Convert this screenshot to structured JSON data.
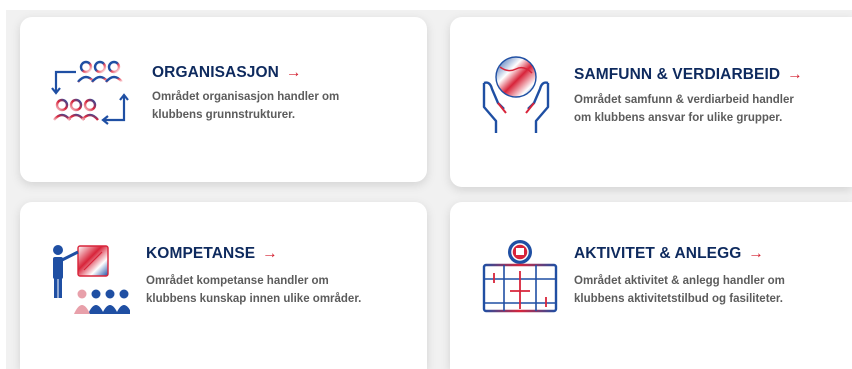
{
  "cards": [
    {
      "title": "ORGANISASJON",
      "arrow": "→",
      "desc_line1": "Området organisasjon handler om",
      "desc_line2": "klubbens grunnstrukturer.",
      "icon": "organization-cycle-icon"
    },
    {
      "title": "SAMFUNN & VERDIARBEID",
      "arrow": "→",
      "desc_line1": "Området samfunn & verdiarbeid handler",
      "desc_line2": "om klubbens ansvar for ulike grupper.",
      "icon": "hands-holding-globe-icon"
    },
    {
      "title": "KOMPETANSE",
      "arrow": "→",
      "desc_line1": "Området kompetanse handler om",
      "desc_line2": "klubbens kunskap innen ulike områder.",
      "icon": "teacher-presentation-icon"
    },
    {
      "title": "AKTIVITET & ANLEGG",
      "arrow": "→",
      "desc_line1": "Området aktivitet & anlegg handler om",
      "desc_line2": "klubbens aktivitetstilbud og fasiliteter.",
      "icon": "facility-field-icon"
    }
  ],
  "colors": {
    "title": "#0e2a5e",
    "arrow": "#d31f2f",
    "icon_blue": "#1f4fa3",
    "icon_red": "#d8243a",
    "text": "#5c5c5c"
  }
}
